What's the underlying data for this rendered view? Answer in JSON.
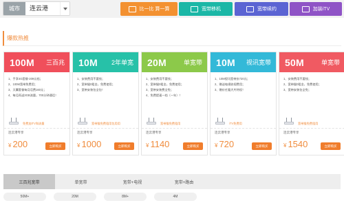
{
  "topbar": {
    "city_label": "城市",
    "city_value": "连云港",
    "buttons": [
      {
        "label": "比一比 算一算",
        "icon": "calculator-icon"
      },
      {
        "label": "宽带移机",
        "icon": "move-icon"
      },
      {
        "label": "宽带续约",
        "icon": "renew-icon"
      },
      {
        "label": "加装iTV",
        "icon": "tv-icon"
      }
    ]
  },
  "section": {
    "title": "爆款热推"
  },
  "cards": [
    {
      "speed": "100M",
      "tag": "三百兆",
      "color": "#f04f5b",
      "features": [
        "1、手享4G套餐-209元档；",
        "2、100M宽带免费用；",
        "3、天翼套餐每月话费160元；",
        "4、每月再送3GB流量，700分钟通话！"
      ],
      "promo": "免费加iTV和流量",
      "shop": "连云港专享",
      "currency": "¥",
      "price": "200",
      "buy": "立即购买"
    },
    {
      "speed": "10M",
      "tag": "2年单宽",
      "color": "#27c1a8",
      "features": [
        "1、安装费用不要钱；",
        "2、宽带猫0租金，免费使用；",
        "3、宽带安装包全包！"
      ],
      "promo": "宽带猫免费租用包用用",
      "shop": "连云港专享",
      "currency": "¥",
      "price": "1000",
      "buy": "立即购买"
    },
    {
      "speed": "20M",
      "tag": "单宽带",
      "color": "#8cc94a",
      "features": [
        "1、安装费用不要钱；",
        "2、宽带猫0租金，免费使用；",
        "3、宽带安装费全免；",
        "4、免费提速一档（一年）！"
      ],
      "promo": "宽带猫免费租用",
      "shop": "连云港专享",
      "currency": "¥",
      "price": "1140",
      "buy": "立即购买"
    },
    {
      "speed": "10M",
      "tag": "视讯宽带",
      "color": "#33b9d8",
      "features": [
        "1、10M视讯宽带仅720元；",
        "2、赠送电视收视费用；",
        "3、赠价任看大片特权！"
      ],
      "promo": "iTV免费用",
      "shop": "连云港专享",
      "currency": "¥",
      "price": "720",
      "buy": "立即购买"
    },
    {
      "speed": "50M",
      "tag": "单宽带",
      "color": "#f05a62",
      "features": [
        "1、安装费用不要钱；",
        "2、宽带猫0租金，免费使用；",
        "3、宽带安装包全免；"
      ],
      "promo": "宽带猫免费租用",
      "shop": "连云港专享",
      "currency": "¥",
      "price": "1540",
      "buy": "立即购买"
    }
  ],
  "tabs": [
    {
      "label": "三百兆宽带",
      "active": true
    },
    {
      "label": "单宽带",
      "active": false
    },
    {
      "label": "宽带+电视",
      "active": false
    },
    {
      "label": "宽带+路由",
      "active": false
    }
  ],
  "filters": [
    "50M+",
    "20M",
    "8M+",
    "4M"
  ]
}
